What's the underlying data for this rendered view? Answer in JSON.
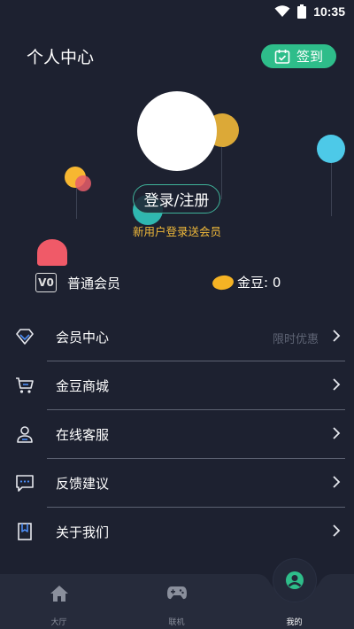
{
  "status_bar": {
    "time": "10:35",
    "wifi_icon": "wifi-icon",
    "battery_icon": "battery-icon"
  },
  "header": {
    "title": "个人中心",
    "signin_label": "签到",
    "signin_icon": "calendar-check-icon"
  },
  "profile": {
    "login_label": "登录/注册",
    "hint": "新用户登录送会员"
  },
  "stats": {
    "member_level": "普通会员",
    "vip_badge_text": "V0",
    "beans_text": "金豆: 0"
  },
  "menu": {
    "items": [
      {
        "label": "会员中心",
        "hint": "限时优惠",
        "icon": "diamond-icon"
      },
      {
        "label": "金豆商城",
        "hint": "",
        "icon": "cart-icon"
      },
      {
        "label": "在线客服",
        "hint": "",
        "icon": "support-agent-icon"
      },
      {
        "label": "反馈建议",
        "hint": "",
        "icon": "message-icon"
      },
      {
        "label": "关于我们",
        "hint": "",
        "icon": "bookmark-icon"
      }
    ]
  },
  "tabs": [
    {
      "label": "大厅",
      "icon": "home-icon"
    },
    {
      "label": "联机",
      "icon": "gamepad-icon"
    },
    {
      "label": "我的",
      "icon": "user-icon"
    }
  ],
  "colors": {
    "background": "#1d2130",
    "accent_green": "#2ebd8a",
    "hint_gold": "#f0b93a",
    "bean_gold": "#f5b324"
  }
}
